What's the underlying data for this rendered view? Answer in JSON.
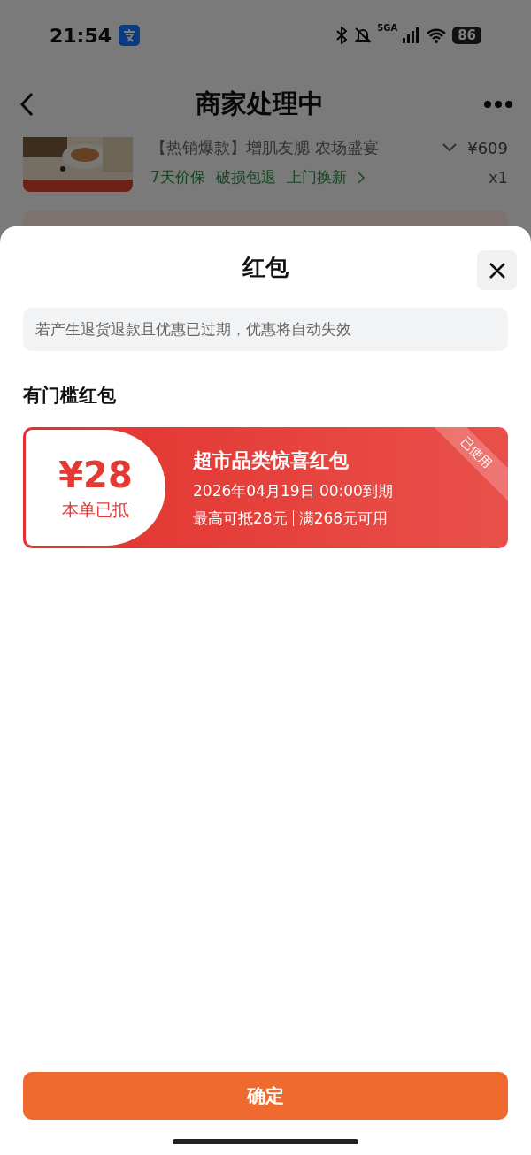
{
  "status_bar": {
    "time": "21:54",
    "network": "5GA",
    "battery": "86"
  },
  "nav": {
    "title": "商家处理中"
  },
  "product": {
    "name": "【热销爆款】增肌友腮 农场盛宴",
    "price": "¥609",
    "tags": [
      "7天价保",
      "破损包退",
      "上门换新"
    ],
    "quantity": "x1"
  },
  "sheet": {
    "title": "红包",
    "notice": "若产生退货退款且优惠已过期，优惠将自动失效",
    "section": "有门槛红包",
    "coupons": [
      {
        "amount": "¥28",
        "status_text": "本单已抵",
        "name": "超市品类惊喜红包",
        "expiry": "2026年04月19日 00:00到期",
        "limit": "最高可抵28元",
        "threshold": "满268元可用",
        "used": true,
        "ribbon": "已使用"
      }
    ],
    "confirm": "确定"
  }
}
